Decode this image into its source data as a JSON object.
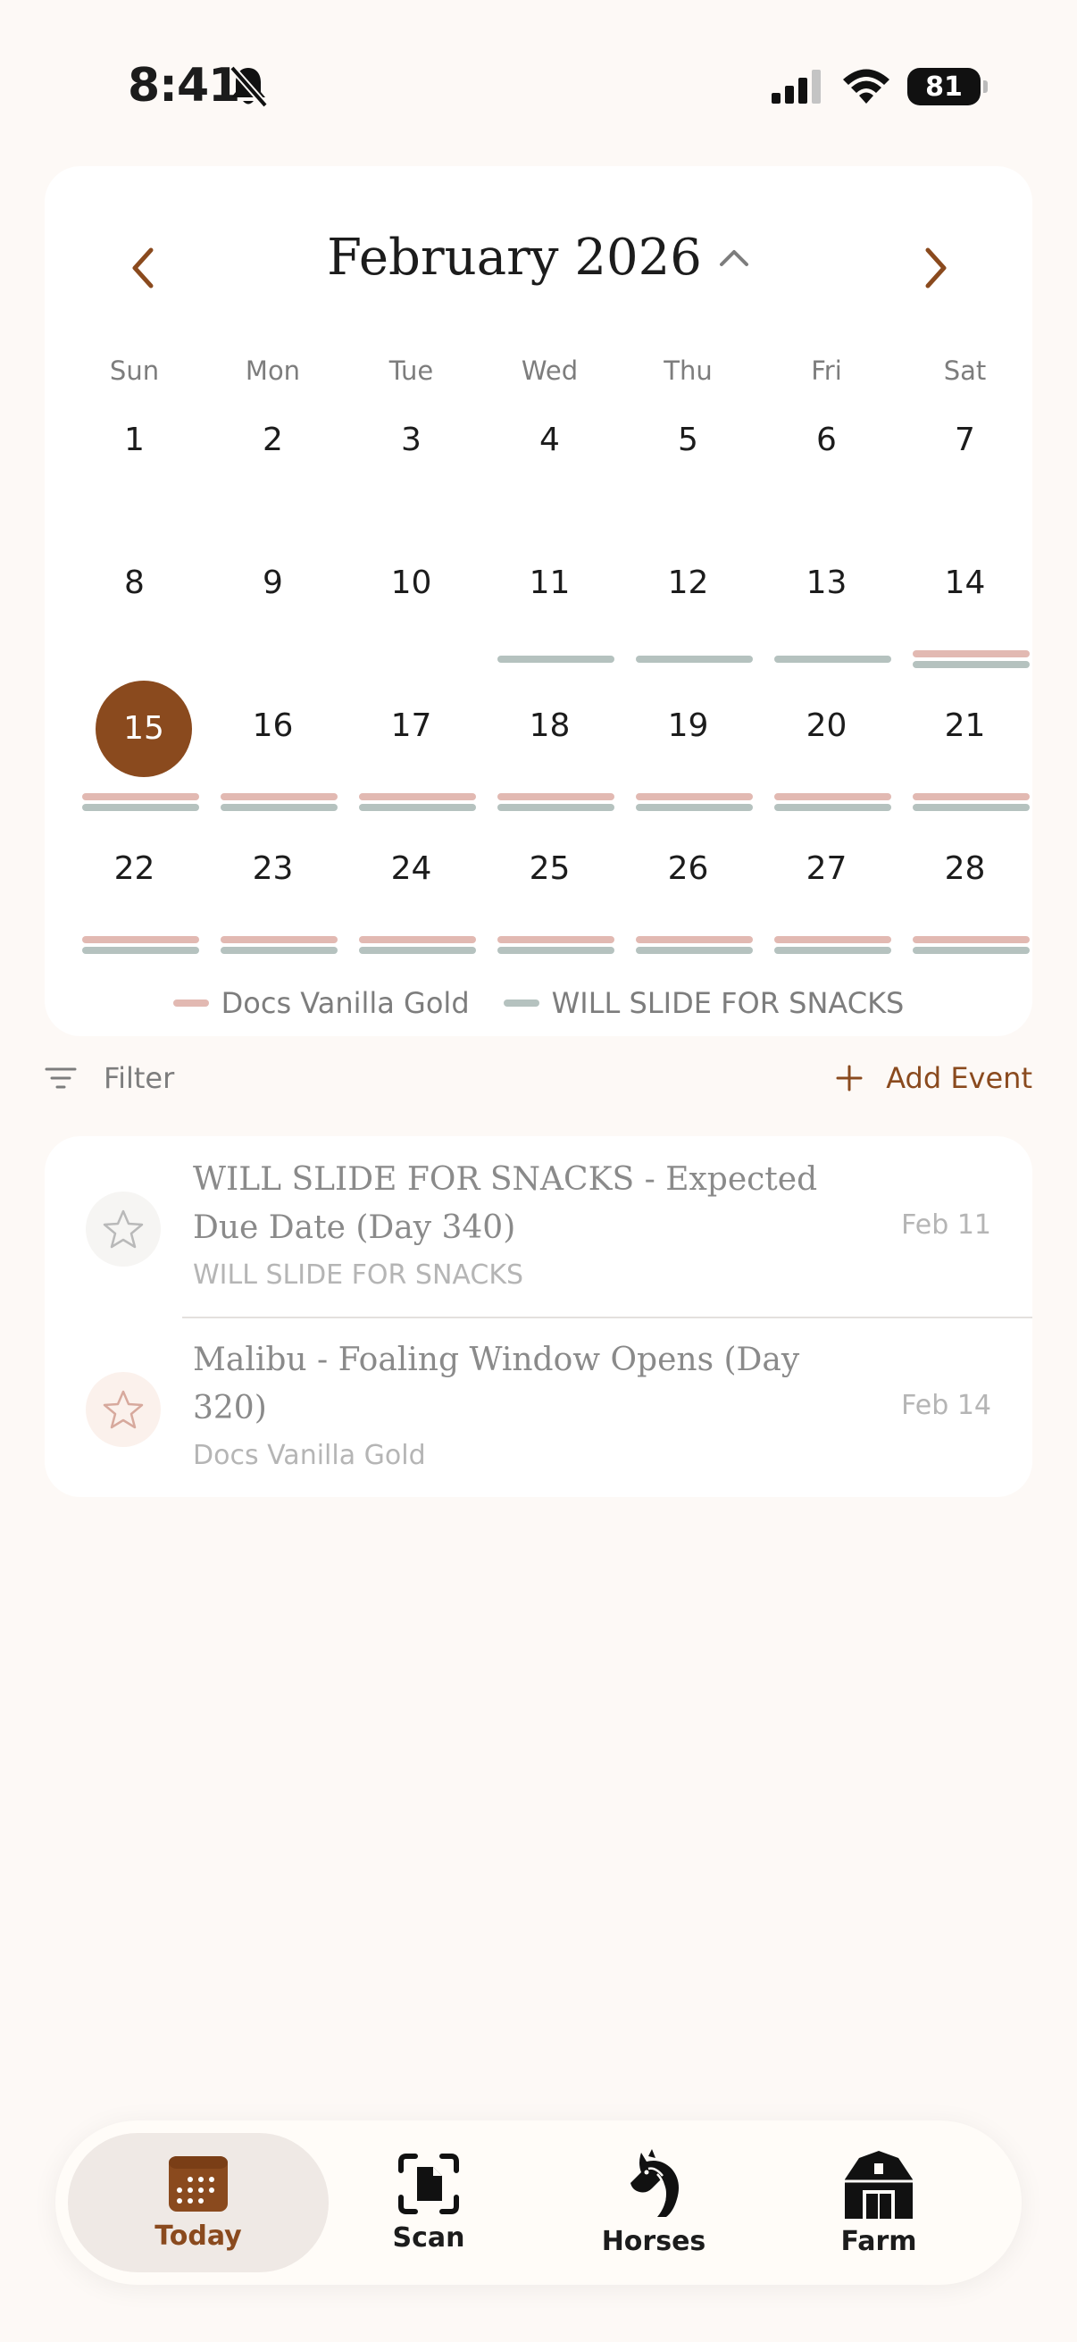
{
  "status_bar": {
    "time": "8:41",
    "battery": "81"
  },
  "calendar": {
    "month_title": "February 2026",
    "weekdays": [
      "Sun",
      "Mon",
      "Tue",
      "Wed",
      "Thu",
      "Fri",
      "Sat"
    ],
    "weeks": [
      [
        "1",
        "2",
        "3",
        "4",
        "5",
        "6",
        "7"
      ],
      [
        "8",
        "9",
        "10",
        "11",
        "12",
        "13",
        "14"
      ],
      [
        "15",
        "16",
        "17",
        "18",
        "19",
        "20",
        "21"
      ],
      [
        "22",
        "23",
        "24",
        "25",
        "26",
        "27",
        "28"
      ]
    ],
    "today": "15",
    "legend": [
      {
        "label": "Docs Vanilla Gold",
        "color": "#e2b9b2"
      },
      {
        "label": "WILL SLIDE FOR SNACKS",
        "color": "#b5c2bf"
      }
    ]
  },
  "toolbar": {
    "filter_label": "Filter",
    "add_event_label": "Add Event"
  },
  "events": [
    {
      "title": "WILL SLIDE FOR SNACKS - Expected Due Date (Day 340)",
      "subtitle": "WILL SLIDE FOR SNACKS",
      "date": "Feb 11"
    },
    {
      "title": "Malibu - Foaling Window Opens (Day 320)",
      "subtitle": "Docs Vanilla Gold",
      "date": "Feb 14"
    }
  ],
  "tabs": [
    {
      "label": "Today",
      "icon": "calendar-icon",
      "active": true
    },
    {
      "label": "Scan",
      "icon": "scan-icon",
      "active": false
    },
    {
      "label": "Horses",
      "icon": "horse-icon",
      "active": false
    },
    {
      "label": "Farm",
      "icon": "barn-icon",
      "active": false
    }
  ],
  "colors": {
    "accent": "#8a4a1e",
    "vanilla_gold": "#e2b9b2",
    "snacks": "#b5c2bf"
  }
}
